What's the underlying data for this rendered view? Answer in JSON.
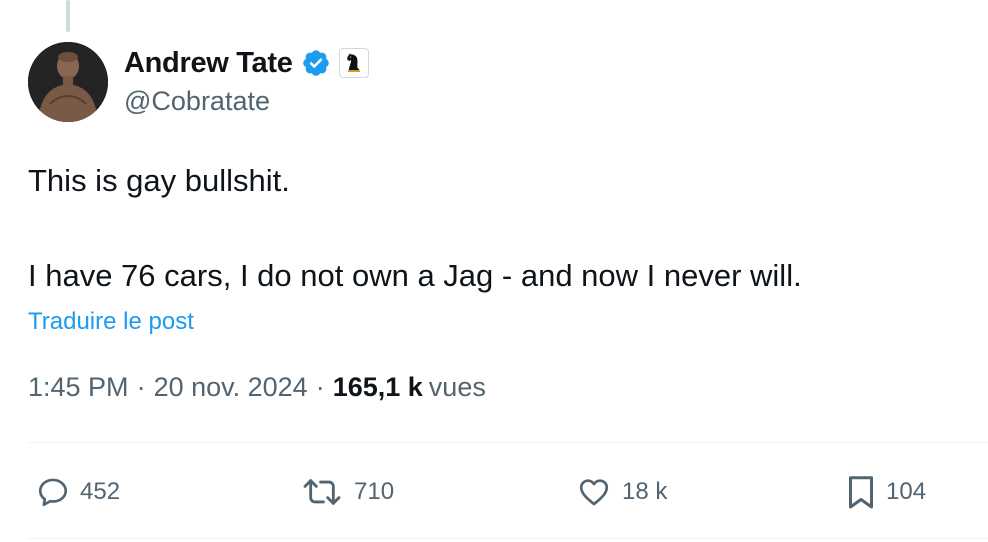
{
  "author": {
    "display_name": "Andrew Tate",
    "handle": "@Cobratate",
    "avatar_icon": "avatar-photo",
    "verified_icon": "verified-badge-icon",
    "affiliate_icon": "chess-knight-badge-icon"
  },
  "tweet": {
    "line1": "This is gay bullshit.",
    "line2": "I have 76 cars, I do not own a Jag - and now I never will.",
    "translate_label": "Traduire le post"
  },
  "meta": {
    "time": "1:45 PM",
    "separator": "·",
    "date": "20 nov. 2024",
    "views_count": "165,1 k",
    "views_label": "vues"
  },
  "actions": {
    "reply_count": "452",
    "repost_count": "710",
    "like_count": "18 k",
    "bookmark_count": "104"
  },
  "colors": {
    "text_primary": "#0f1419",
    "text_secondary": "#536471",
    "link_blue": "#1d9bf0",
    "verified_blue": "#1d9bf0",
    "divider": "#eff3f4"
  }
}
